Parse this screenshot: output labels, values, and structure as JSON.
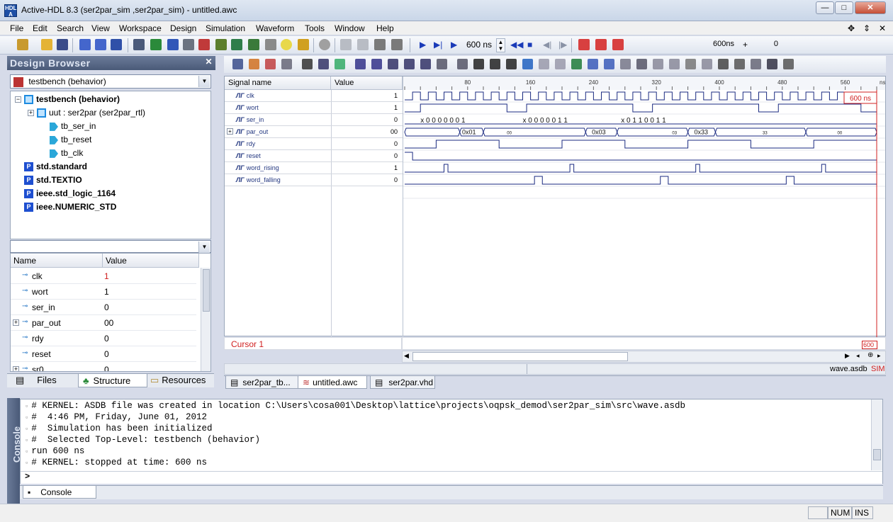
{
  "window": {
    "title": "Active-HDL 8.3 (ser2par_sim ,ser2par_sim) - untitled.awc",
    "app_icon_text": "HDL A"
  },
  "menu": [
    "File",
    "Edit",
    "Search",
    "View",
    "Workspace",
    "Design",
    "Simulation",
    "Waveform",
    "Tools",
    "Window",
    "Help"
  ],
  "toolbar": {
    "run_time": "600 ns",
    "time_field": "600ns",
    "plus": "+",
    "step": "0"
  },
  "design_browser": {
    "title": "Design Browser",
    "combo": "testbench (behavior)",
    "tree": [
      {
        "label": "testbench (behavior)",
        "bold": true,
        "indent": 0,
        "icon": "component-icon",
        "exp": "−"
      },
      {
        "label": "uut : ser2par (ser2par_rtl)",
        "indent": 1,
        "icon": "component-icon",
        "exp": "+"
      },
      {
        "label": "tb_ser_in",
        "indent": 2,
        "icon": "port-icon"
      },
      {
        "label": "tb_reset",
        "indent": 2,
        "icon": "port-icon"
      },
      {
        "label": "tb_clk",
        "indent": 2,
        "icon": "port-icon"
      },
      {
        "label": "std.standard",
        "bold": true,
        "indent": 0,
        "icon": "package-icon"
      },
      {
        "label": "std.TEXTIO",
        "bold": true,
        "indent": 0,
        "icon": "package-icon"
      },
      {
        "label": "ieee.std_logic_1164",
        "bold": true,
        "indent": 0,
        "icon": "package-icon"
      },
      {
        "label": "ieee.NUMERIC_STD",
        "bold": true,
        "indent": 0,
        "icon": "package-icon"
      }
    ],
    "grid_headers": {
      "name": "Name",
      "value": "Value"
    },
    "grid_rows": [
      {
        "name": "clk",
        "value": "1",
        "red": true
      },
      {
        "name": "wort",
        "value": "1"
      },
      {
        "name": "ser_in",
        "value": "0"
      },
      {
        "name": "par_out",
        "value": "00",
        "exp": "+"
      },
      {
        "name": "rdy",
        "value": "0"
      },
      {
        "name": "reset",
        "value": "0"
      },
      {
        "name": "sr0",
        "value": "0",
        "exp": "+"
      }
    ],
    "tabs": [
      "Files",
      "Structure",
      "Resources"
    ]
  },
  "waveform": {
    "headers": {
      "name": "Signal name",
      "value": "Value"
    },
    "ruler_ticks": [
      "80",
      "160",
      "240",
      "320",
      "400",
      "480",
      "560"
    ],
    "ruler_unit": "ns",
    "cursor_label": "600 ns",
    "cursor_row": "Cursor 1",
    "cursor_box": "600",
    "signals": [
      {
        "name": "clk",
        "value": "1"
      },
      {
        "name": "wort",
        "value": "1"
      },
      {
        "name": "ser_in",
        "value": "0"
      },
      {
        "name": "par_out",
        "value": "00",
        "bus": true
      },
      {
        "name": "rdy",
        "value": "0"
      },
      {
        "name": "reset",
        "value": "0"
      },
      {
        "name": "word_rising",
        "value": "1"
      },
      {
        "name": "word_falling",
        "value": "0"
      }
    ],
    "bus_labels": [
      "x 0 0 0 0 0 0 1",
      "x 0 0 0 0 0 1 1",
      "x 0 1 1 0 0 1 1",
      "0x01",
      "00",
      "0x03",
      "03",
      "0x33",
      "33",
      "00"
    ],
    "status_right": "wave.asdb",
    "status_sim": "SIM"
  },
  "doc_tabs": [
    "ser2par_tb...",
    "untitled.awc",
    "ser2par.vhd"
  ],
  "console": {
    "title": "Console",
    "lines": [
      "# KERNEL: ASDB file was created in location C:\\Users\\cosa001\\Desktop\\lattice\\projects\\oqpsk_demod\\ser2par_sim\\src\\wave.asdb",
      "#  4:46 PM, Friday, June 01, 2012",
      "#  Simulation has been initialized",
      "#  Selected Top-Level: testbench (behavior)",
      "run 600 ns",
      "# KERNEL: stopped at time: 600 ns"
    ],
    "prompt": ">",
    "tab": "Console"
  },
  "status": {
    "num": "NUM",
    "ins": "INS"
  }
}
